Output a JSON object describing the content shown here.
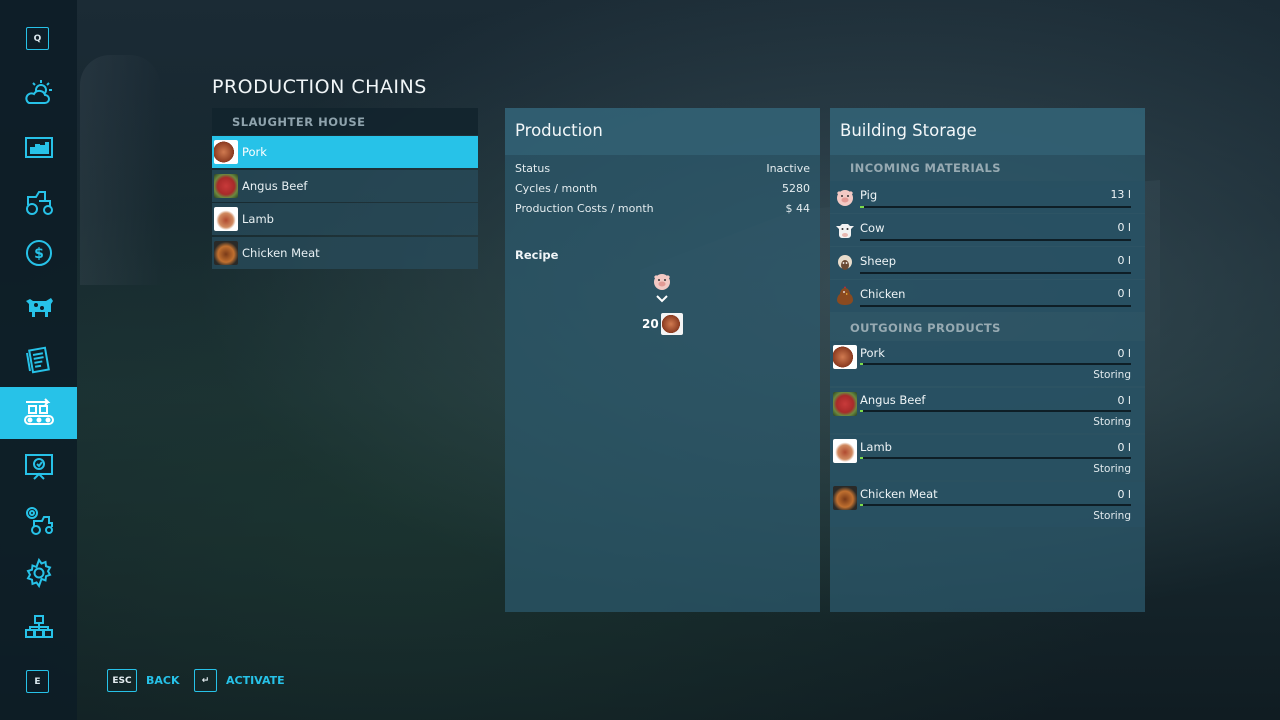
{
  "nav": {
    "key_top": "Q",
    "key_bottom": "E",
    "items": [
      {
        "icon": "weather-icon"
      },
      {
        "icon": "statistics-icon"
      },
      {
        "icon": "tractor-icon"
      },
      {
        "icon": "finance-icon"
      },
      {
        "icon": "animals-icon"
      },
      {
        "icon": "contracts-icon"
      },
      {
        "icon": "production-chains-icon",
        "active": true
      },
      {
        "icon": "tutorial-icon"
      },
      {
        "icon": "garage-icon"
      },
      {
        "icon": "settings-icon"
      },
      {
        "icon": "multiplayer-icon"
      }
    ]
  },
  "page_title": "PRODUCTION CHAINS",
  "chains": {
    "header": "SLAUGHTER HOUSE",
    "items": [
      {
        "label": "Pork",
        "selected": true
      },
      {
        "label": "Angus Beef"
      },
      {
        "label": "Lamb"
      },
      {
        "label": "Chicken Meat"
      }
    ]
  },
  "production": {
    "title": "Production",
    "stats": [
      {
        "label": "Status",
        "value": "Inactive"
      },
      {
        "label": "Cycles / month",
        "value": "5280"
      },
      {
        "label": "Production Costs / month",
        "value": "$ 44"
      }
    ],
    "recipe_label": "Recipe",
    "recipe_output_qty": "20"
  },
  "storage": {
    "title": "Building Storage",
    "incoming_label": "INCOMING MATERIALS",
    "incoming": [
      {
        "name": "Pig",
        "amount": "13 l",
        "icon": "pig-icon",
        "fill": 0.01
      },
      {
        "name": "Cow",
        "amount": "0 l",
        "icon": "cow-icon",
        "fill": 0
      },
      {
        "name": "Sheep",
        "amount": "0 l",
        "icon": "sheep-icon",
        "fill": 0
      },
      {
        "name": "Chicken",
        "amount": "0 l",
        "icon": "chicken-icon",
        "fill": 0
      }
    ],
    "outgoing_label": "OUTGOING PRODUCTS",
    "outgoing": [
      {
        "name": "Pork",
        "amount": "0 l",
        "mode": "Storing"
      },
      {
        "name": "Angus Beef",
        "amount": "0 l",
        "mode": "Storing"
      },
      {
        "name": "Lamb",
        "amount": "0 l",
        "mode": "Storing"
      },
      {
        "name": "Chicken Meat",
        "amount": "0 l",
        "mode": "Storing"
      }
    ]
  },
  "footer": {
    "back_key": "ESC",
    "back_label": "BACK",
    "activate_key": "↵",
    "activate_label": "ACTIVATE"
  },
  "colors": {
    "accent": "#27c2e8",
    "panel": "#2d5a6e",
    "fill_green": "#7bdc4a"
  }
}
